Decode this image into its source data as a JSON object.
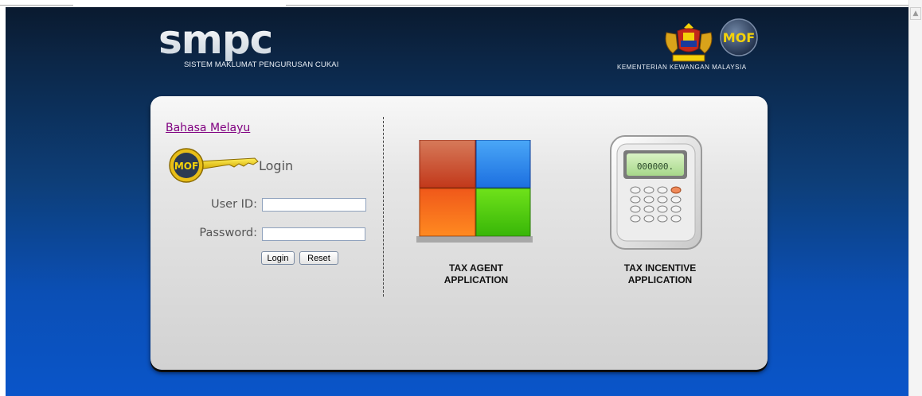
{
  "header": {
    "logo_text": "smpc",
    "subtitle": "SISTEM MAKLUMAT PENGURUSAN CUKAI",
    "ministry_label": "KEMENTERIAN KEWANGAN MALAYSIA",
    "mof_badge": "MOF"
  },
  "login": {
    "language_link": "Bahasa Melayu",
    "title": "Login",
    "key_badge": "MOF",
    "user_id_label": "User ID:",
    "user_id_value": "",
    "password_label": "Password:",
    "password_value": "",
    "login_button": "Login",
    "reset_button": "Reset"
  },
  "apps": [
    {
      "line1": "TAX AGENT",
      "line2": "APPLICATION",
      "icon": "windows-tiles-icon"
    },
    {
      "line1": "TAX INCENTIVE",
      "line2": "APPLICATION",
      "icon": "calculator-icon"
    }
  ],
  "calculator_display": "000000.",
  "colors": {
    "background_top": "#0a1a2f",
    "background_bottom": "#0a55c9",
    "link_color": "#800080",
    "tile_red": "#d9532f",
    "tile_blue": "#2f8ff0",
    "tile_orange": "#f25a10",
    "tile_green": "#66cc11"
  }
}
